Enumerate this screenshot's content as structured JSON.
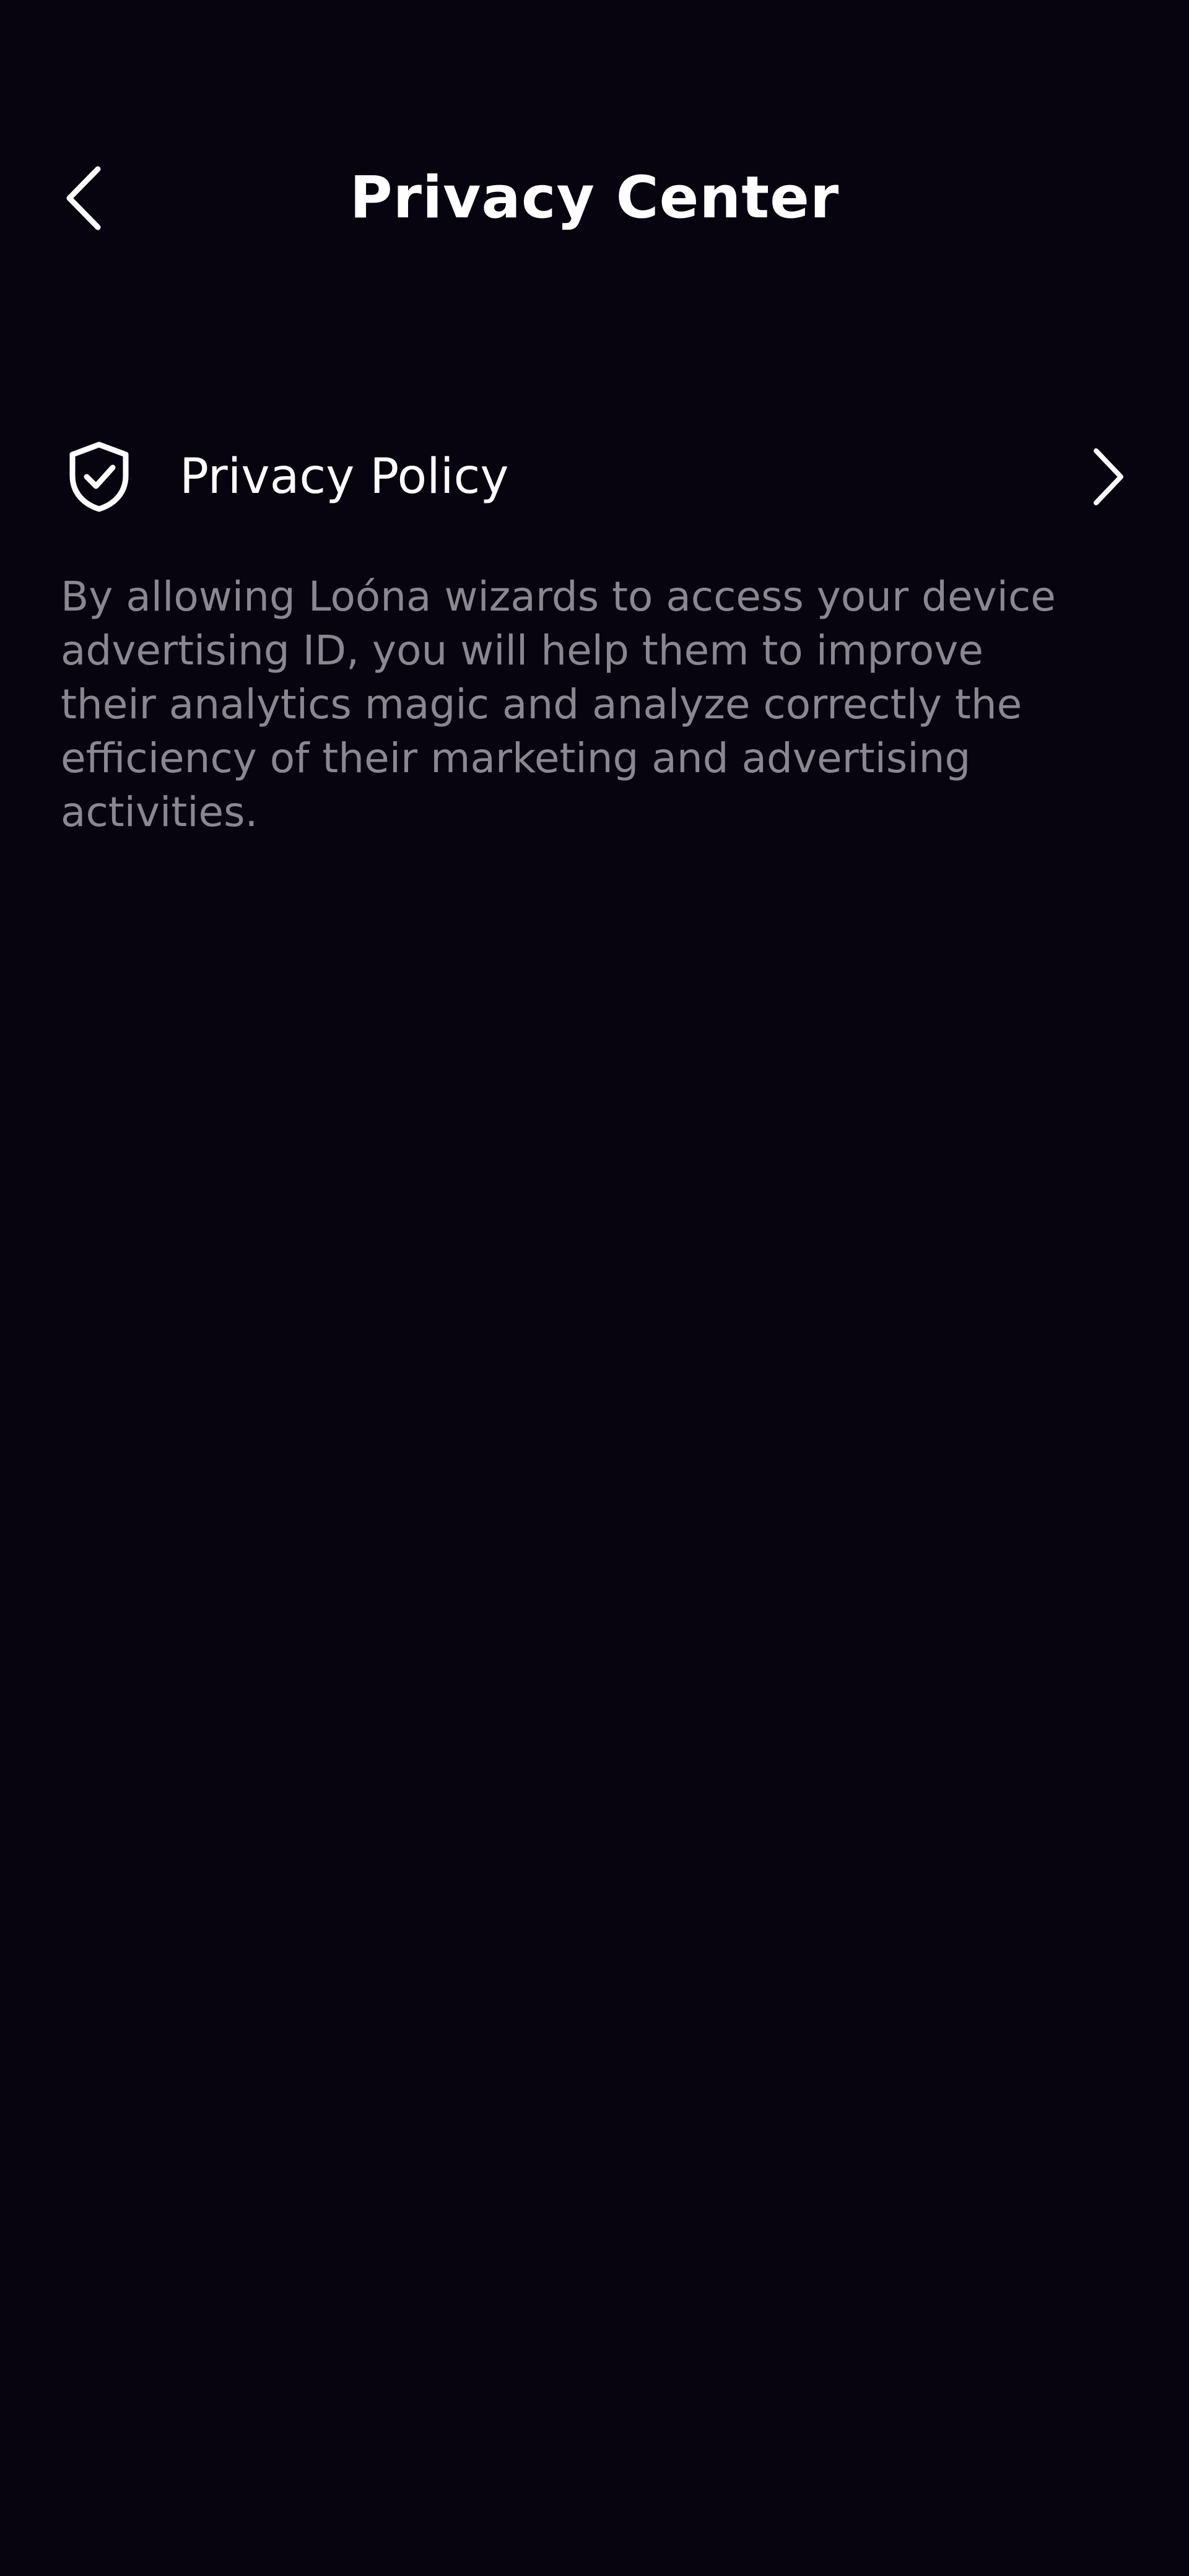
{
  "header": {
    "title": "Privacy Center",
    "back_icon": "chevron-left-icon"
  },
  "privacy_policy": {
    "icon": "shield-check-icon",
    "label": "Privacy Policy",
    "chevron_icon": "chevron-right-icon"
  },
  "description": "By allowing Loóna wizards to access your device advertising ID, you will help them to improve their analytics magic and analyze correctly the efficiency of their marketing and advertising activities.",
  "colors": {
    "background": "#07030f",
    "title_text": "#ffffff",
    "body_text": "#8a8790"
  }
}
